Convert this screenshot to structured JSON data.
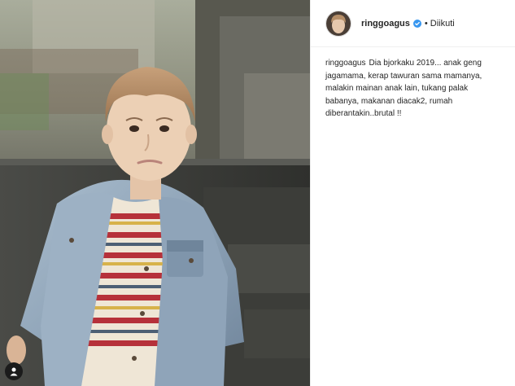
{
  "post": {
    "username": "ringgoagus",
    "follow_status": "Diikuti",
    "dot": "•",
    "caption_user": "ringgoagus",
    "caption_text": "Dia bjorkaku 2019... anak geng jagamama, kerap tawuran sama mamanya, malakin mainan anak lain, tukang palak babanya, makanan diacak2, rumah diberantakin..brutal !!"
  },
  "icons": {
    "verified": "verified-check-icon",
    "tagged_people": "user-icon"
  },
  "colors": {
    "verified_blue": "#3897f0",
    "text": "#262626",
    "border": "#efefef"
  }
}
